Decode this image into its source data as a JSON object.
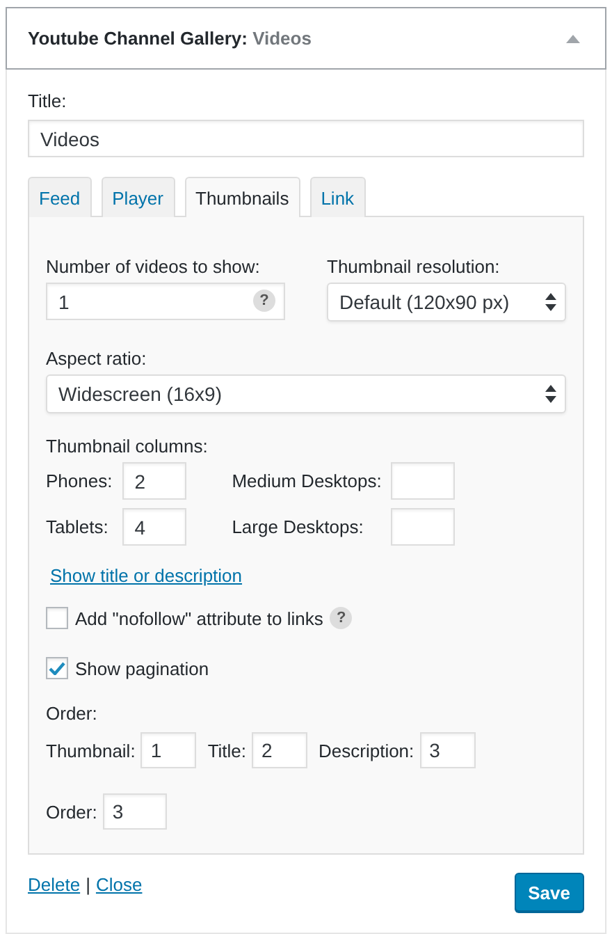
{
  "widget": {
    "title": "Youtube Channel Gallery:",
    "subtitle": "Videos",
    "expanded": true
  },
  "title_field": {
    "label": "Title:",
    "value": "Videos"
  },
  "tabs": [
    {
      "label": "Feed",
      "selected": false
    },
    {
      "label": "Player",
      "selected": false
    },
    {
      "label": "Thumbnails",
      "selected": true
    },
    {
      "label": "Link",
      "selected": false
    }
  ],
  "panel": {
    "videos_count": {
      "label": "Number of videos to show:",
      "value": "1",
      "help": "?"
    },
    "resolution": {
      "label": "Thumbnail resolution:",
      "value": "Default (120x90 px)"
    },
    "aspect_ratio": {
      "label": "Aspect ratio:",
      "value": "Widescreen (16x9)"
    },
    "columns": {
      "label": "Thumbnail columns:",
      "fields": [
        {
          "label": "Phones:",
          "value": "2"
        },
        {
          "label": "Medium Desktops:"
        },
        {
          "label": "Tablets:",
          "value": "4"
        },
        {
          "label": "Large Desktops:"
        }
      ]
    },
    "link": "Show title or description",
    "checkboxes": [
      {
        "label": "Add \"nofollow\" attribute to links",
        "checked": false,
        "help": "?"
      },
      {
        "label": "Show pagination",
        "checked": true
      }
    ],
    "order": {
      "label": "Order:",
      "fields": [
        {
          "label": "Thumbnail:",
          "value": "1"
        },
        {
          "label": "Title:",
          "value": "2"
        },
        {
          "label": "Description:",
          "value": "3"
        }
      ]
    },
    "order_field": {
      "label": "Order:",
      "value": "3"
    }
  },
  "footer": {
    "links": [
      "Delete",
      "Close"
    ],
    "separator": "|",
    "save": "Save"
  }
}
